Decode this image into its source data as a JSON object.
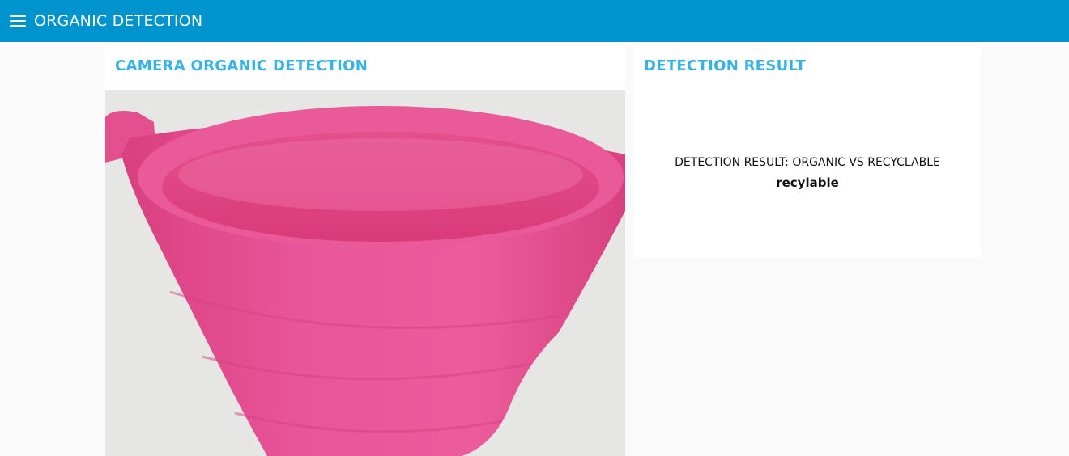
{
  "header": {
    "title": "ORGANIC DETECTION",
    "menu_icon": "hamburger-menu-icon",
    "background": "#0094ce"
  },
  "camera_panel": {
    "title": "CAMERA ORGANIC DETECTION",
    "image": "pink-plastic-cup-camera-frame"
  },
  "result_panel": {
    "title": "DETECTION RESULT",
    "label": "DETECTION RESULT: ORGANIC VS RECYCLABLE",
    "value": "recylable"
  },
  "colors": {
    "accent": "#35b2e8",
    "cup": "#e8538f"
  }
}
